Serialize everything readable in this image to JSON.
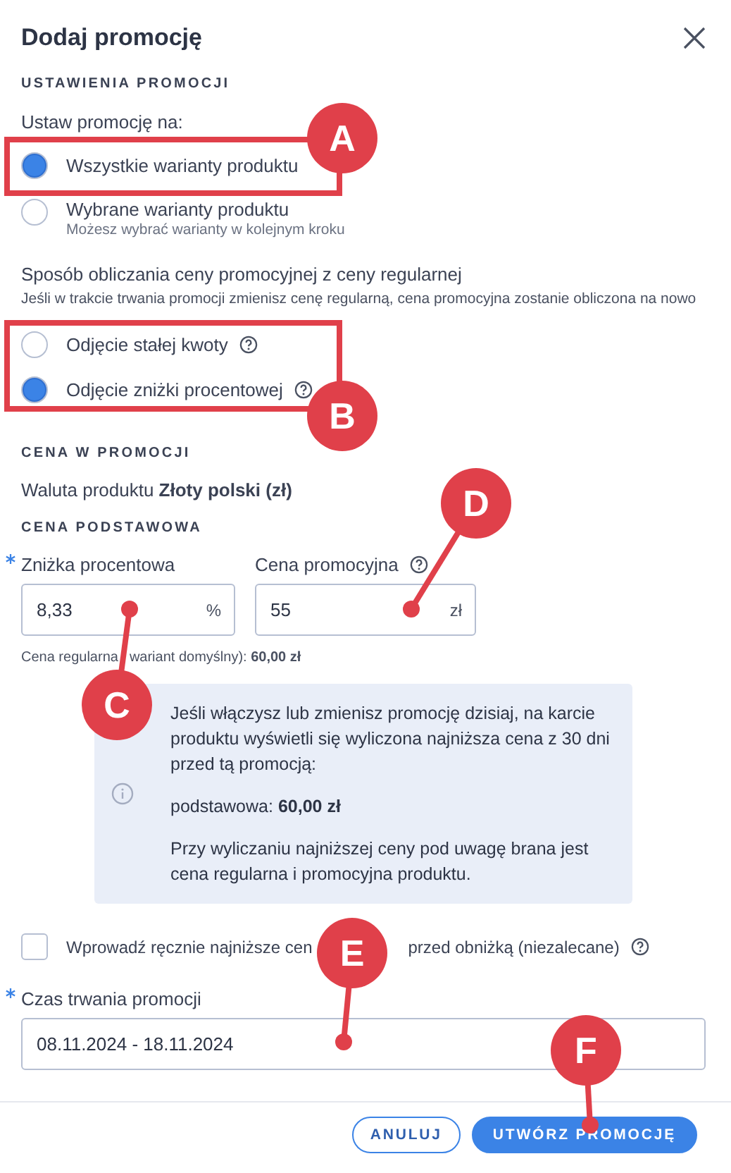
{
  "dialog": {
    "title": "Dodaj promocję"
  },
  "settings": {
    "heading": "USTAWIENIA PROMOCJI",
    "target_label": "Ustaw promocję na:",
    "target_options": [
      {
        "label": "Wszystkie warianty produktu",
        "selected": true
      },
      {
        "label": "Wybrane warianty produktu",
        "hint": "Możesz wybrać warianty w kolejnym kroku",
        "selected": false
      }
    ],
    "method_label": "Sposób obliczania ceny promocyjnej z ceny regularnej",
    "method_hint": "Jeśli w trakcie trwania promocji zmienisz cenę regularną, cena promocyjna zostanie obliczona na nowo",
    "method_options": [
      {
        "label": "Odjęcie stałej kwoty",
        "help": true,
        "selected": false
      },
      {
        "label": "Odjęcie zniżki procentowej",
        "help": true,
        "selected": true
      }
    ]
  },
  "price": {
    "heading": "CENA W PROMOCJI",
    "currency": "Waluta produktu **Złoty polski (zł)**",
    "subheading": "CENA PODSTAWOWA",
    "fields": [
      {
        "label": "Zniżka procentowa",
        "required": true,
        "help": false,
        "value": "8,33",
        "unit": "%"
      },
      {
        "label": "Cena promocyjna",
        "required": false,
        "help": true,
        "value": "55",
        "unit": "zł"
      }
    ],
    "regular_price_parts": [
      "Cena regularna",
      "wariant domyślny): **60,00 zł**"
    ]
  },
  "info": {
    "paragraphs": [
      "Jeśli włączysz lub zmienisz promocję dzisiaj, na karcie produktu wyświetli się wyliczona najniższa cena z 30 dni przed tą promocją:",
      "podstawowa: **60,00 zł**",
      "Przy wyliczaniu najniższej ceny pod uwagę brana jest cena regularna i promocyjna produktu."
    ]
  },
  "manual_lowest": {
    "checked": false,
    "label_parts": [
      "Wprowadź ręcznie najniższe cen",
      "przed obniżką (niezalecane)"
    ],
    "help": true
  },
  "duration": {
    "label": "Czas trwania promocji",
    "required": true,
    "value": "08.11.2024 - 18.11.2024"
  },
  "buttons": [
    {
      "label": "ANULUJ",
      "kind": "secondary"
    },
    {
      "label": "UTWÓRZ PROMOCJĘ",
      "kind": "primary"
    }
  ],
  "annotations": [
    {
      "label": "A",
      "kind": "frame"
    },
    {
      "label": "B",
      "kind": "frame"
    },
    {
      "label": "C",
      "kind": "pointer"
    },
    {
      "label": "D",
      "kind": "pointer"
    },
    {
      "label": "E",
      "kind": "pointer"
    },
    {
      "label": "F",
      "kind": "pointer"
    }
  ]
}
